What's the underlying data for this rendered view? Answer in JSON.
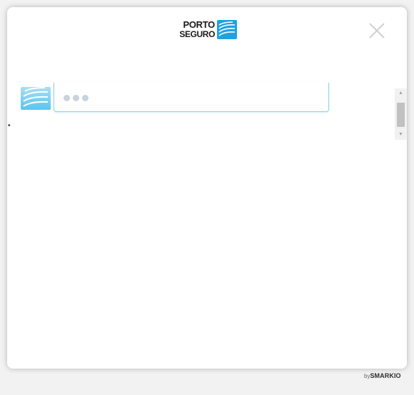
{
  "header": {
    "logo_line1": "PORTO",
    "logo_line2": "SEGURO",
    "close_label": "×"
  },
  "chat": {
    "typing_indicator": "typing",
    "bullet": "•"
  },
  "footer": {
    "by_label": "by",
    "brand": "SMARKIO"
  },
  "colors": {
    "brand_blue": "#1fa3e0",
    "bubble_border": "#8fd3f1",
    "dot": "#c9d3dc"
  },
  "icons": {
    "close": "close-icon",
    "logo": "porto-seguro-logo",
    "avatar": "bot-avatar-icon"
  }
}
